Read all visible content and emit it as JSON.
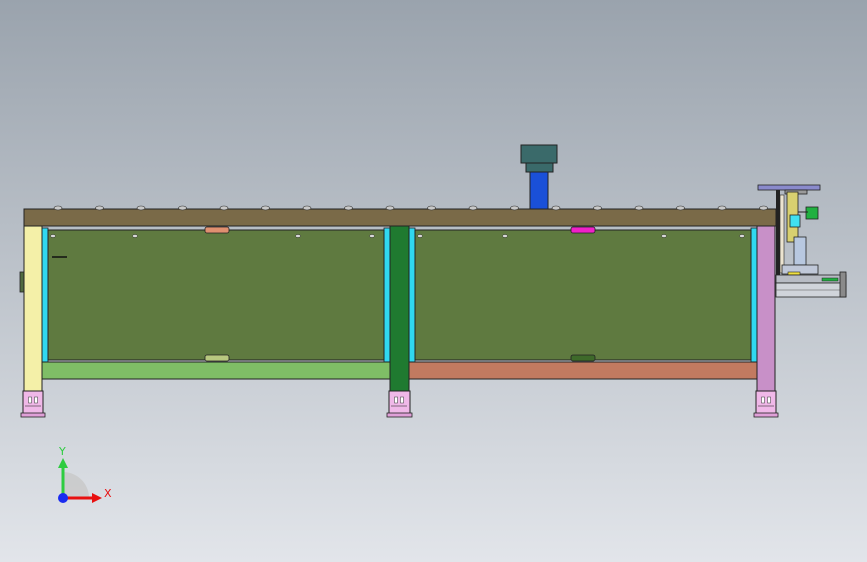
{
  "viewport": {
    "background_top": "#9aa3ad",
    "background_bottom": "#e2e5ea"
  },
  "triad": {
    "y_label": "Y",
    "x_label": "X",
    "y_color": "#2ecc40",
    "x_color": "#e81010",
    "z_color": "#1a2cf0"
  },
  "colors": {
    "top_plate": "#7a6a48",
    "panel_fill": "#5f7a40",
    "beam_left": "#7fbe66",
    "beam_right": "#c27a60",
    "leg_left": "#f4f0a8",
    "leg_mid": "#1f7a30",
    "leg_right": "#c890c8",
    "foot": "#f0b8e8",
    "cyan_frame": "#30d8f0",
    "column_blue": "#1a50d8",
    "column_cap": "#3a6a6a"
  }
}
